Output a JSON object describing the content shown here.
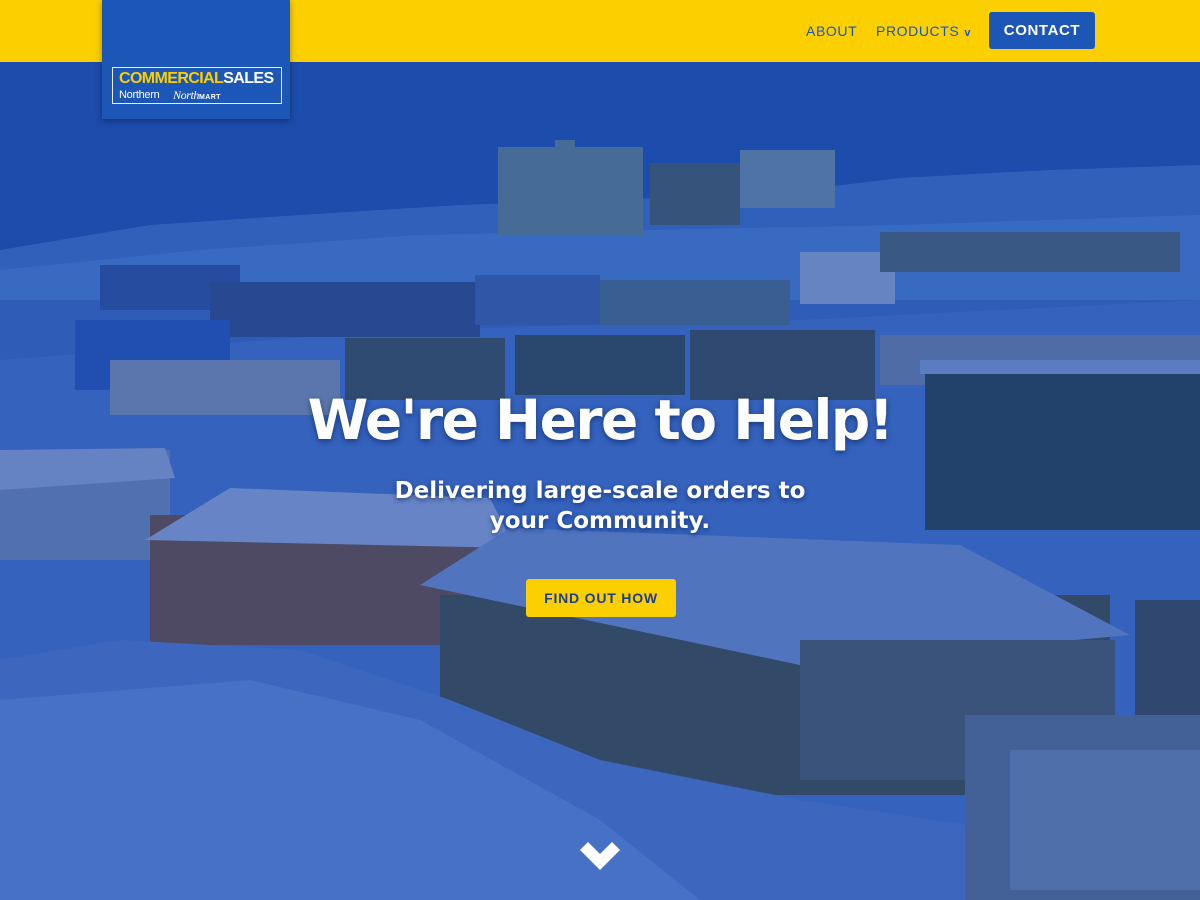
{
  "header": {
    "logo": {
      "title_part1": "COMMERCIAL",
      "title_part2": "SALES",
      "brand1": "Northern",
      "brand2_script": "North",
      "brand2_caps": "MART"
    },
    "nav": {
      "about": "ABOUT",
      "products": "PRODUCTS",
      "products_chevron": "v",
      "contact": "CONTACT"
    }
  },
  "hero": {
    "title": "We're Here to Help!",
    "subtitle_line1": "Delivering large-scale orders to",
    "subtitle_line2": "your Community.",
    "cta": "FIND OUT HOW",
    "scroll_icon": "chevron-down-icon"
  },
  "colors": {
    "yellow": "#fccf00",
    "brand_blue": "#1c57b8",
    "overlay_blue": "#1b47a8",
    "text_white": "#ffffff"
  }
}
